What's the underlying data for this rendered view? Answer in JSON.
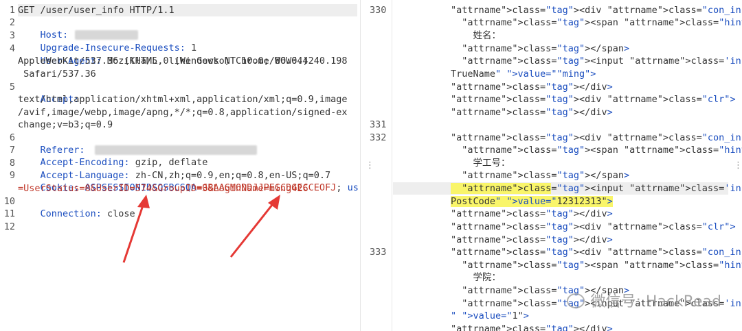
{
  "request": {
    "lines": [
      {
        "num": "1",
        "text": "GET /user/user_info HTTP/1.1"
      },
      {
        "num": "2",
        "key": "Host:",
        "value": ""
      },
      {
        "num": "3",
        "key": "Upgrade-Insecure-Requests:",
        "value": " 1"
      },
      {
        "num": "4",
        "key": "User-Agent:",
        "value": " Mozilla/5.0 (Windows NT 10.0; WOW64)"
      },
      {
        "num": "",
        "text": "AppleWebKit/537.36 (KHTML, like Gecko) Chrome/86.0.4240.198"
      },
      {
        "num": "",
        "text": " Safari/537.36"
      },
      {
        "num": "5",
        "key": "Accept:",
        "value": ""
      },
      {
        "num": "",
        "text": "text/html,application/xhtml+xml,application/xml;q=0.9,image"
      },
      {
        "num": "",
        "text": "/avif,image/webp,image/apng,*/*;q=0.8,application/signed-ex"
      },
      {
        "num": "",
        "text": "change;v=b3;q=0.9"
      },
      {
        "num": "6",
        "key": "Referer:",
        "value": ""
      },
      {
        "num": "7",
        "key": "Accept-Encoding:",
        "value": " gzip, deflate"
      },
      {
        "num": "8",
        "key": "Accept-Language:",
        "value": " zh-CN,zh;q=0.9,en;q=0.8,en-US;q=0.7"
      },
      {
        "num": "9",
        "key": "Cookie:",
        "cookie_name": " ASPSESSIONIDSQSBCSQA",
        "cookie_eq": "=",
        "cookie_val": "GBAAGMODDJJPEGCDGECCEOFJ",
        "cookie_sep": "; ",
        "cookie_name2": "user"
      },
      {
        "num": "",
        "cookie_cont": "=UserStatus=0&UserID=574&GroupID=3&LoginName=ming426"
      },
      {
        "num": "10",
        "key": "Connection:",
        "value": " close"
      },
      {
        "num": "11",
        "text": ""
      },
      {
        "num": "12",
        "text": ""
      }
    ]
  },
  "response": {
    "line_numbers": [
      {
        "num": "330"
      },
      {
        "num": "331"
      },
      {
        "num": "332"
      },
      {
        "num": "333"
      }
    ],
    "code": [
      "<div class=\"con_input\">",
      "  <span class=\"hint\">",
      "    姓名：",
      "  </span>",
      "  <input class='input' type=\"text\" name=\"",
      "TrueName\" value=\"\"ming\">",
      "</div>",
      "<div class=\"clr\">",
      "</div>",
      "",
      "<div class=\"con_input\">",
      "  <span class=\"hint\">",
      "    学工号：",
      "  </span>",
      "  <input class='input' type=\"text\" name=\"",
      "PostCode\" value=\"12312313\">",
      "</div>",
      "<div class=\"clr\">",
      "</div>",
      "<div class=\"con_input\">",
      "  <span class=\"hint\">",
      "    学院：",
      "  </span>",
      "  <input class='input' type=\"text\" name=\"",
      "\" value=\"1\">",
      "</div>"
    ]
  },
  "watermark": "微信号: HackRead",
  "colors": {
    "highlight_yellow": "#f9f56a",
    "arrow_red": "#e53935",
    "key_blue": "#1a4dbf",
    "value_red": "#c0392b"
  },
  "icons": {
    "drag_handle": "vertical-dots-icon"
  }
}
